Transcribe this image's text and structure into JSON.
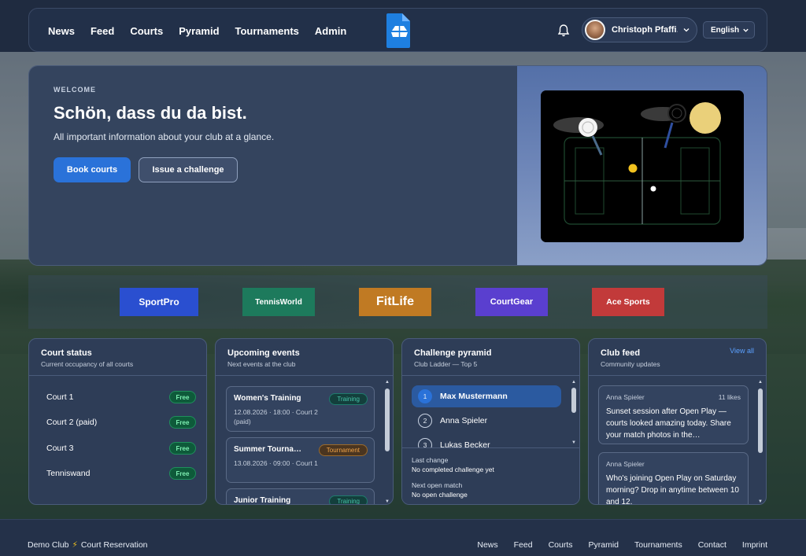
{
  "nav": {
    "links": [
      "News",
      "Feed",
      "Courts",
      "Pyramid",
      "Tournaments",
      "Admin"
    ],
    "user_name": "Christoph Pfaffi…",
    "language": "English"
  },
  "hero": {
    "eyebrow": "WELCOME",
    "title": "Schön, dass du da bist.",
    "subtitle": "All important information about your club at a glance.",
    "primary_button": "Book courts",
    "secondary_button": "Issue a challenge"
  },
  "sponsors": [
    {
      "name": "SportPro",
      "color": "#2a4fd0"
    },
    {
      "name": "TennisWorld",
      "color": "#1d7a5c"
    },
    {
      "name": "FitLife",
      "color": "#c07a23"
    },
    {
      "name": "CourtGear",
      "color": "#5a3fcf"
    },
    {
      "name": "Ace Sports",
      "color": "#c23a3a"
    }
  ],
  "court_status": {
    "title": "Court status",
    "subtitle": "Current occupancy of all courts",
    "courts": [
      {
        "name": "Court 1",
        "status": "Free"
      },
      {
        "name": "Court 2 (paid)",
        "status": "Free"
      },
      {
        "name": "Court 3",
        "status": "Free"
      },
      {
        "name": "Tenniswand",
        "status": "Free"
      }
    ]
  },
  "events": {
    "title": "Upcoming events",
    "subtitle": "Next events at the club",
    "items": [
      {
        "title": "Women's Training",
        "meta": "12.08.2026 · 18:00 · Court 2 (paid)",
        "tag": "Training"
      },
      {
        "title": "Summer Tourna…",
        "meta": "13.08.2026 · 09:00 · Court 1",
        "tag": "Tournament"
      },
      {
        "title": "Junior Training",
        "meta": "",
        "tag": "Training"
      }
    ]
  },
  "pyramid": {
    "title": "Challenge pyramid",
    "subtitle": "Club Ladder — Top 5",
    "players": [
      {
        "rank": "1",
        "name": "Max Mustermann"
      },
      {
        "rank": "2",
        "name": "Anna Spieler"
      },
      {
        "rank": "3",
        "name": "Lukas Becker"
      }
    ],
    "last_change_label": "Last change",
    "last_change_value": "No completed challenge yet",
    "next_match_label": "Next open match",
    "next_match_value": "No open challenge"
  },
  "feed": {
    "title": "Club feed",
    "subtitle": "Community updates",
    "view_all": "View all",
    "posts": [
      {
        "author": "Anna Spieler",
        "likes": "11 likes",
        "text": "Sunset session after Open Play — courts looked amazing today. Share your match photos in the…"
      },
      {
        "author": "Anna Spieler",
        "likes": "",
        "text": "Who's joining Open Play on Saturday morning? Drop in anytime between 10 and 12."
      }
    ]
  },
  "footer": {
    "brand": "Demo Club",
    "brand_suffix": "Court Reservation",
    "links": [
      "News",
      "Feed",
      "Courts",
      "Pyramid",
      "Tournaments",
      "Contact",
      "Imprint"
    ]
  },
  "colors": {
    "accent": "#2a72d9",
    "free_badge": "#0e5a3a"
  }
}
